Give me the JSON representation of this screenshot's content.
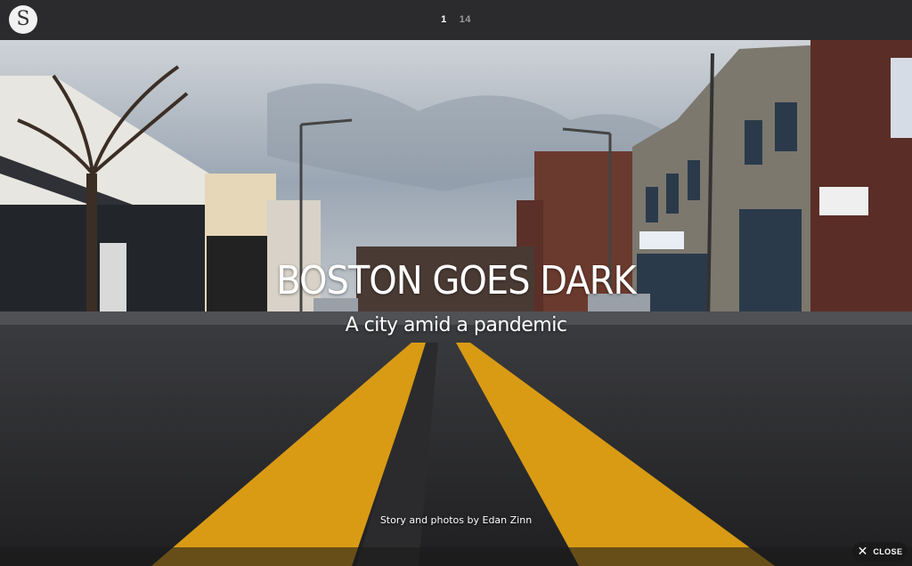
{
  "app": {
    "logo_letter": "S"
  },
  "pager": {
    "current": "1",
    "total": "14"
  },
  "hero": {
    "title": "BOSTON GOES DARK",
    "subtitle": "A city amid a pandemic",
    "byline": "Story and photos by Edan Zinn"
  },
  "controls": {
    "close_label": "CLOSE"
  },
  "colors": {
    "topbar": "#2b2b2d",
    "road_line": "#d99b14",
    "asphalt": "#2a2a2c",
    "sky": "#a7b0bb"
  }
}
